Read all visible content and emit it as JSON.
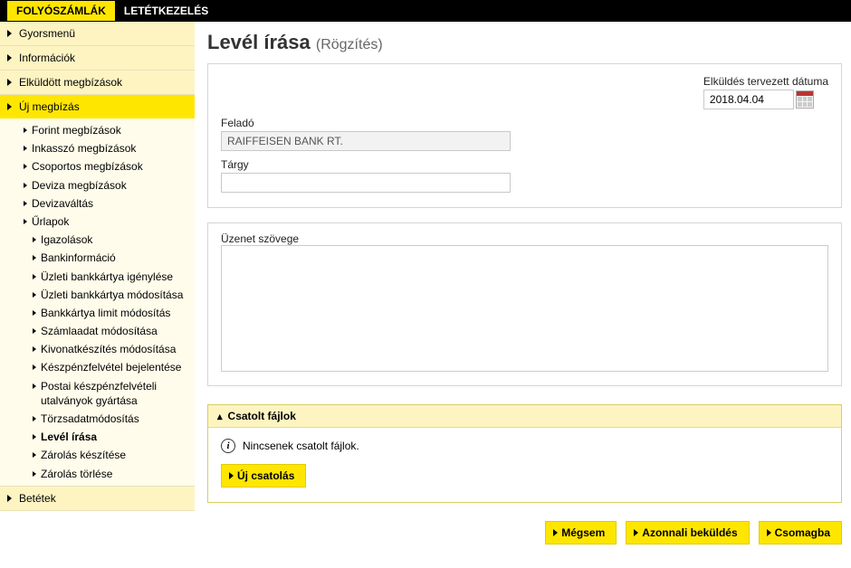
{
  "topnav": {
    "active": "FOLYÓSZÁMLÁK",
    "inactive": "LETÉTKEZELÉS"
  },
  "sidebar": {
    "gyorsmenu": "Gyorsmenü",
    "informaciok": "Információk",
    "elkuldott": "Elküldött megbízások",
    "uj_megbizas": "Új megbízás",
    "sub1": {
      "forint": "Forint megbízások",
      "inkasszo": "Inkasszó megbízások",
      "csoportos": "Csoportos megbízások",
      "deviza": "Deviza megbízások",
      "devizavaltas": "Devizaváltás",
      "urlapok": "Űrlapok"
    },
    "sub2": {
      "igazolasok": "Igazolások",
      "bankinfo": "Bankinformáció",
      "uzleti_igeny": "Üzleti bankkártya igénylése",
      "uzleti_mod": "Üzleti bankkártya módosítása",
      "bankkartya_limit": "Bankkártya limit módosítás",
      "szamla_mod": "Számlaadat módosítása",
      "kivonat": "Kivonatkészítés módosítása",
      "keszpenz": "Készpénzfelvétel bejelentése",
      "postai": "Postai készpénzfelvételi utalványok gyártása",
      "torzs": "Törzsadatmódosítás",
      "level": "Levél írása",
      "zarolas_k": "Zárolás készítése",
      "zarolas_t": "Zárolás törlése"
    },
    "betetek": "Betétek"
  },
  "page": {
    "title": "Levél írása",
    "subtitle": "(Rögzítés)"
  },
  "form": {
    "date_label": "Elküldés tervezett dátuma",
    "date_value": "2018.04.04",
    "felado_label": "Feladó",
    "felado_value": "RAIFFEISEN BANK RT.",
    "targy_label": "Tárgy",
    "targy_value": "",
    "uzenet_label": "Üzenet szövege",
    "uzenet_value": ""
  },
  "attach": {
    "header": "Csatolt fájlok",
    "empty": "Nincsenek csatolt fájlok.",
    "new_button": "Új csatolás"
  },
  "actions": {
    "cancel": "Mégsem",
    "send_now": "Azonnali beküldés",
    "package": "Csomagba"
  }
}
